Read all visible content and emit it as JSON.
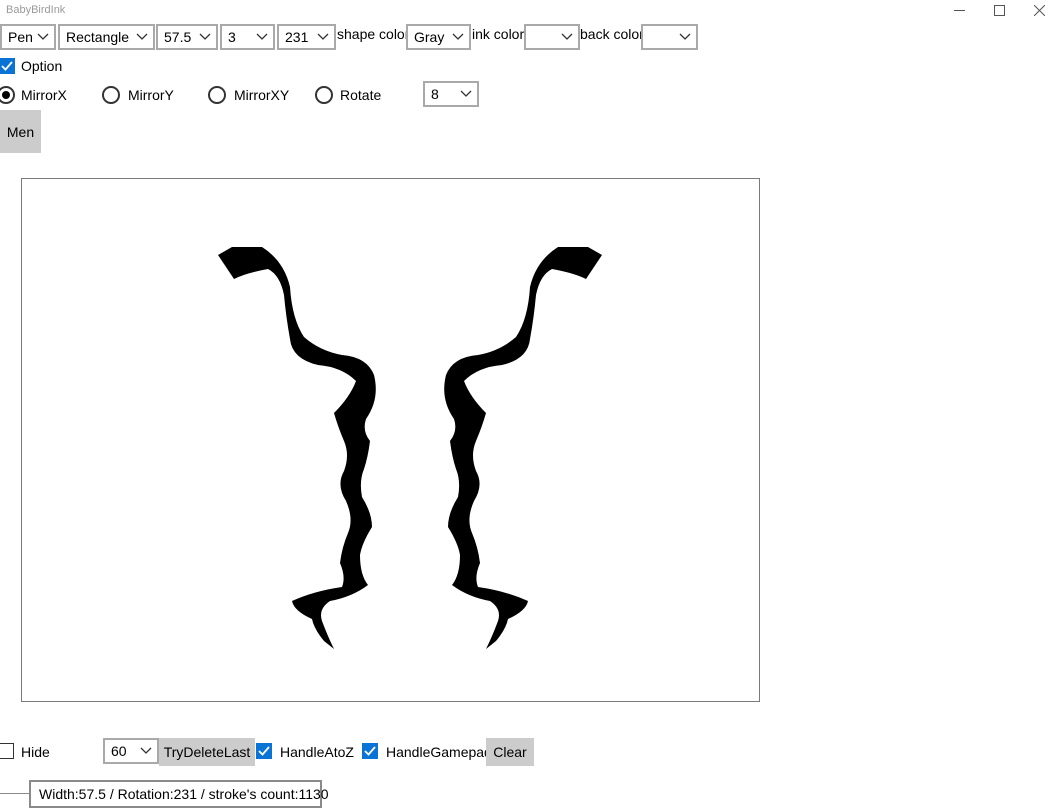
{
  "window": {
    "title": "BabyBirdInk",
    "controls": {
      "minimize_icon": "minimize-icon",
      "maximize_icon": "maximize-icon",
      "close_icon": "close-icon"
    }
  },
  "toolbar": {
    "tool": "Pen",
    "shape": "Rectangle",
    "width": "57.5",
    "count": "3",
    "rotation": "231",
    "shape_color_label": "shape color",
    "shape_color": "Gray",
    "ink_color_label": "ink color",
    "ink_color": "",
    "back_color_label": "back color",
    "back_color": ""
  },
  "options": {
    "option_label": "Option",
    "option_checked": true,
    "mirror": [
      {
        "label": "MirrorX",
        "selected": true
      },
      {
        "label": "MirrorY",
        "selected": false
      },
      {
        "label": "MirrorXY",
        "selected": false
      },
      {
        "label": "Rotate",
        "selected": false
      }
    ],
    "rotate_count": "8"
  },
  "menu_button": "Men",
  "bottom": {
    "hide_label": "Hide",
    "hide_checked": false,
    "interval": "60",
    "try_delete_last": "TryDeleteLast",
    "handle_atoz_label": "HandleAtoZ",
    "handle_atoz_checked": true,
    "handle_gamepad_label": "HandleGamepad",
    "handle_gamepad_checked": true,
    "clear": "Clear"
  },
  "status": "Width:57.5 / Rotation:231 / stroke's count:1130",
  "colors": {
    "accent": "#0a74d6",
    "button_gray": "#cccccc",
    "ink": "#000000"
  }
}
